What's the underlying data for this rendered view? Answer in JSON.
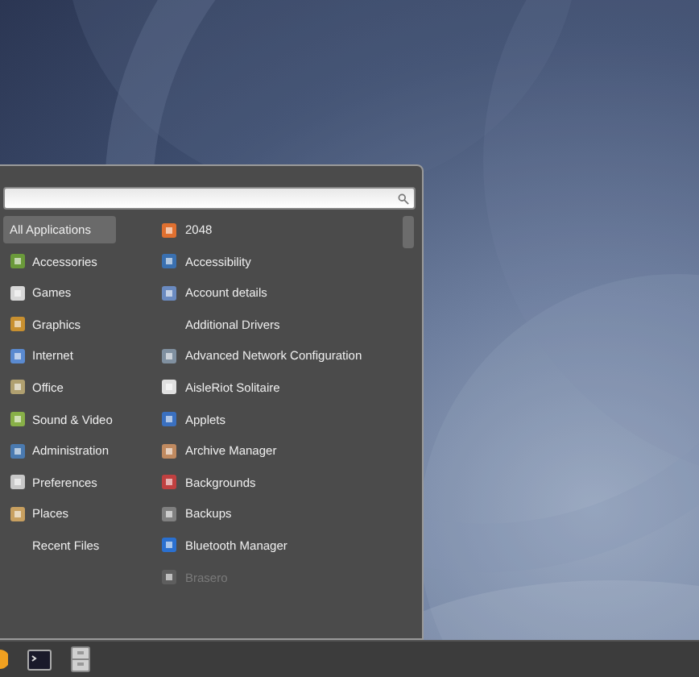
{
  "categories": [
    {
      "label": "All Applications",
      "selected": true
    },
    {
      "label": "Accessories",
      "selected": false
    },
    {
      "label": "Games",
      "selected": false
    },
    {
      "label": "Graphics",
      "selected": false
    },
    {
      "label": "Internet",
      "selected": false
    },
    {
      "label": "Office",
      "selected": false
    },
    {
      "label": "Sound & Video",
      "selected": false
    },
    {
      "label": "Administration",
      "selected": false
    },
    {
      "label": "Preferences",
      "selected": false
    },
    {
      "label": "Places",
      "selected": false
    },
    {
      "label": "Recent Files",
      "selected": false
    }
  ],
  "applications": [
    {
      "label": "2048",
      "disabled": false
    },
    {
      "label": "Accessibility",
      "disabled": false
    },
    {
      "label": "Account details",
      "disabled": false
    },
    {
      "label": "Additional Drivers",
      "disabled": false
    },
    {
      "label": "Advanced Network Configuration",
      "disabled": false
    },
    {
      "label": "AisleRiot Solitaire",
      "disabled": false
    },
    {
      "label": "Applets",
      "disabled": false
    },
    {
      "label": "Archive Manager",
      "disabled": false
    },
    {
      "label": "Backgrounds",
      "disabled": false
    },
    {
      "label": "Backups",
      "disabled": false
    },
    {
      "label": "Bluetooth Manager",
      "disabled": false
    },
    {
      "label": "Brasero",
      "disabled": true
    }
  ]
}
